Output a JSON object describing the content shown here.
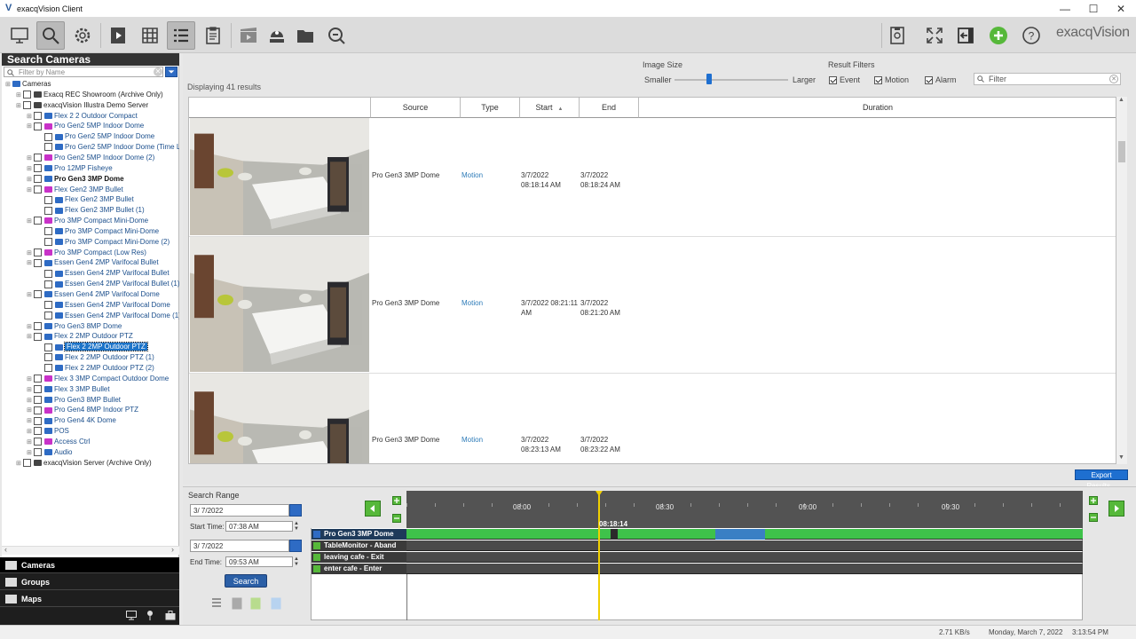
{
  "window": {
    "title": "exacqVision Client",
    "logo_glyph": "V",
    "minimize": "—",
    "maximize": "☐",
    "close": "✕"
  },
  "toolbar": {
    "brand": "exacqVision",
    "icons": [
      "monitor-icon",
      "search-icon",
      "gear-icon",
      "playback-icon",
      "grid-icon",
      "list-icon",
      "clipboard-icon",
      "export-clip-icon",
      "user-icon",
      "folder-icon",
      "search-zoom-icon",
      "memory-icon",
      "fullscreen-icon",
      "exit-icon",
      "add-icon",
      "help-icon"
    ]
  },
  "left": {
    "title": "Search Cameras",
    "filter_placeholder": "Filter by Name",
    "tree": [
      {
        "label": "Cameras",
        "level": 0
      },
      {
        "label": "Exacq REC Showroom (Archive Only)",
        "level": 1
      },
      {
        "label": "exacqVision Illustra Demo Server",
        "level": 1
      },
      {
        "label": "Flex 2 2 Outdoor Compact",
        "level": 2
      },
      {
        "label": "Pro Gen2 5MP Indoor Dome",
        "level": 2
      },
      {
        "label": "Pro Gen2 5MP Indoor Dome",
        "level": 3
      },
      {
        "label": "Pro Gen2 5MP Indoor Dome  (Time Lap",
        "level": 3
      },
      {
        "label": "Pro Gen2 5MP Indoor Dome (2)",
        "level": 2
      },
      {
        "label": "Pro 12MP Fisheye",
        "level": 2
      },
      {
        "label": "Pro Gen3 3MP Dome",
        "level": 2,
        "bold": true
      },
      {
        "label": "Flex Gen2 3MP Bullet",
        "level": 2
      },
      {
        "label": "Flex Gen2 3MP Bullet",
        "level": 3
      },
      {
        "label": "Flex Gen2 3MP Bullet (1)",
        "level": 3
      },
      {
        "label": "Pro 3MP Compact Mini-Dome",
        "level": 2
      },
      {
        "label": "Pro 3MP Compact Mini-Dome",
        "level": 3
      },
      {
        "label": "Pro 3MP Compact Mini-Dome (2)",
        "level": 3
      },
      {
        "label": "Pro 3MP Compact (Low Res)",
        "level": 2
      },
      {
        "label": "Essen Gen4 2MP Varifocal Bullet",
        "level": 2
      },
      {
        "label": "Essen Gen4 2MP Varifocal Bullet",
        "level": 3
      },
      {
        "label": "Essen Gen4 2MP Varifocal Bullet (1)",
        "level": 3
      },
      {
        "label": "Essen Gen4 2MP Varifocal Dome",
        "level": 2
      },
      {
        "label": "Essen Gen4 2MP Varifocal Dome",
        "level": 3
      },
      {
        "label": "Essen Gen4 2MP Varifocal Dome (1)",
        "level": 3
      },
      {
        "label": "Pro Gen3 8MP Dome",
        "level": 2
      },
      {
        "label": "Flex 2 2MP Outdoor PTZ",
        "level": 2
      },
      {
        "label": "Flex 2 2MP Outdoor PTZ",
        "level": 3,
        "selected": true
      },
      {
        "label": "Flex 2 2MP Outdoor PTZ (1)",
        "level": 3
      },
      {
        "label": "Flex 2 2MP Outdoor PTZ (2)",
        "level": 3
      },
      {
        "label": "Flex 3 3MP Compact Outdoor Dome",
        "level": 2
      },
      {
        "label": "Flex 3 3MP Bullet",
        "level": 2
      },
      {
        "label": "Pro Gen3 8MP Bullet",
        "level": 2
      },
      {
        "label": "Pro Gen4 8MP Indoor PTZ",
        "level": 2
      },
      {
        "label": "Pro Gen4 4K Dome",
        "level": 2
      },
      {
        "label": "POS",
        "level": 2
      },
      {
        "label": "Access Ctrl",
        "level": 2
      },
      {
        "label": "Audio",
        "level": 2
      },
      {
        "label": "exacqVision Server (Archive Only)",
        "level": 1
      }
    ],
    "nav": [
      {
        "label": "Cameras"
      },
      {
        "label": "Groups"
      },
      {
        "label": "Maps"
      }
    ]
  },
  "results": {
    "count_text": "Displaying 41 results",
    "image_size_label": "Image Size",
    "smaller": "Smaller",
    "larger": "Larger",
    "image_size_level": 0.28,
    "filters_label": "Result Filters",
    "filter_event": "Event",
    "filter_motion": "Motion",
    "filter_alarm": "Alarm",
    "filter_placeholder": "Filter",
    "columns": [
      "",
      "Source",
      "Type",
      "Start",
      "End",
      "Duration"
    ],
    "rows": [
      {
        "source": "Pro Gen3 3MP Dome",
        "type": "Motion",
        "start": "3/7/2022 08:18:14 AM",
        "end": "3/7/2022 08:18:24 AM"
      },
      {
        "source": "Pro Gen3 3MP Dome",
        "type": "Motion",
        "start": "3/7/2022 08:21:11 AM",
        "end": "3/7/2022 08:21:20 AM"
      },
      {
        "source": "Pro Gen3 3MP Dome",
        "type": "Motion",
        "start": "3/7/2022 08:23:13 AM",
        "end": "3/7/2022 08:23:22 AM"
      }
    ],
    "export_label": "Export Results..."
  },
  "search": {
    "range_label": "Search Range",
    "start_date": "3/ 7/2022",
    "start_time_label": "Start Time:",
    "start_time": "07:38 AM",
    "end_date": "3/ 7/2022",
    "end_time_label": "End Time:",
    "end_time": "09:53 AM",
    "search_label": "Search"
  },
  "timeline": {
    "ticks": [
      "08:00",
      "08:30",
      "09:00",
      "09:30"
    ],
    "cursor_label": "08:18:14",
    "tracks": [
      {
        "label": "Pro Gen3 3MP Dome"
      },
      {
        "label": "TableMonitor - Aband"
      },
      {
        "label": "leaving cafe - Exit"
      },
      {
        "label": "enter cafe - Enter"
      }
    ]
  },
  "status": {
    "rate": "2.71 KB/s",
    "date": "Monday, March 7, 2022",
    "time": "3:13:54 PM"
  },
  "colors": {
    "accent": "#1e6fd0",
    "green": "#56b83a",
    "timeline_green": "#3ec24a",
    "timeline_blue": "#3a7fc4",
    "cursor": "#f0d000"
  }
}
